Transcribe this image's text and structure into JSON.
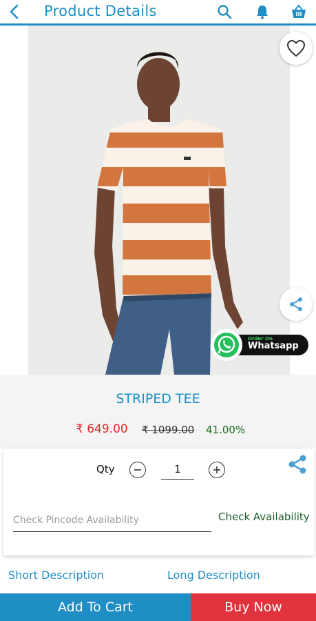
{
  "header": {
    "title": "Product Details",
    "icons": [
      "back-arrow-icon",
      "search-icon",
      "bell-icon",
      "basket-icon"
    ],
    "accent_color": "#1f8ec4"
  },
  "product": {
    "name": "STRIPED TEE",
    "price": "₹ 649.00",
    "mrp": "₹ 1099.00",
    "discount": "41.00%",
    "price_color": "#e02a2a",
    "discount_color": "#1b6b1b"
  },
  "whatsapp": {
    "top_text": "Order On",
    "label": "Whatsapp"
  },
  "quantity": {
    "label": "Qty",
    "value": "1"
  },
  "pincode": {
    "placeholder": "Check Pincode Availability",
    "button_label": "Check Availability"
  },
  "descriptions": {
    "short_label": "Short Description",
    "long_label": "Long Description"
  },
  "actions": {
    "add_to_cart": "Add To Cart",
    "buy_now": "Buy Now",
    "cart_color": "#1f8ec4",
    "buy_color": "#e0333e"
  }
}
